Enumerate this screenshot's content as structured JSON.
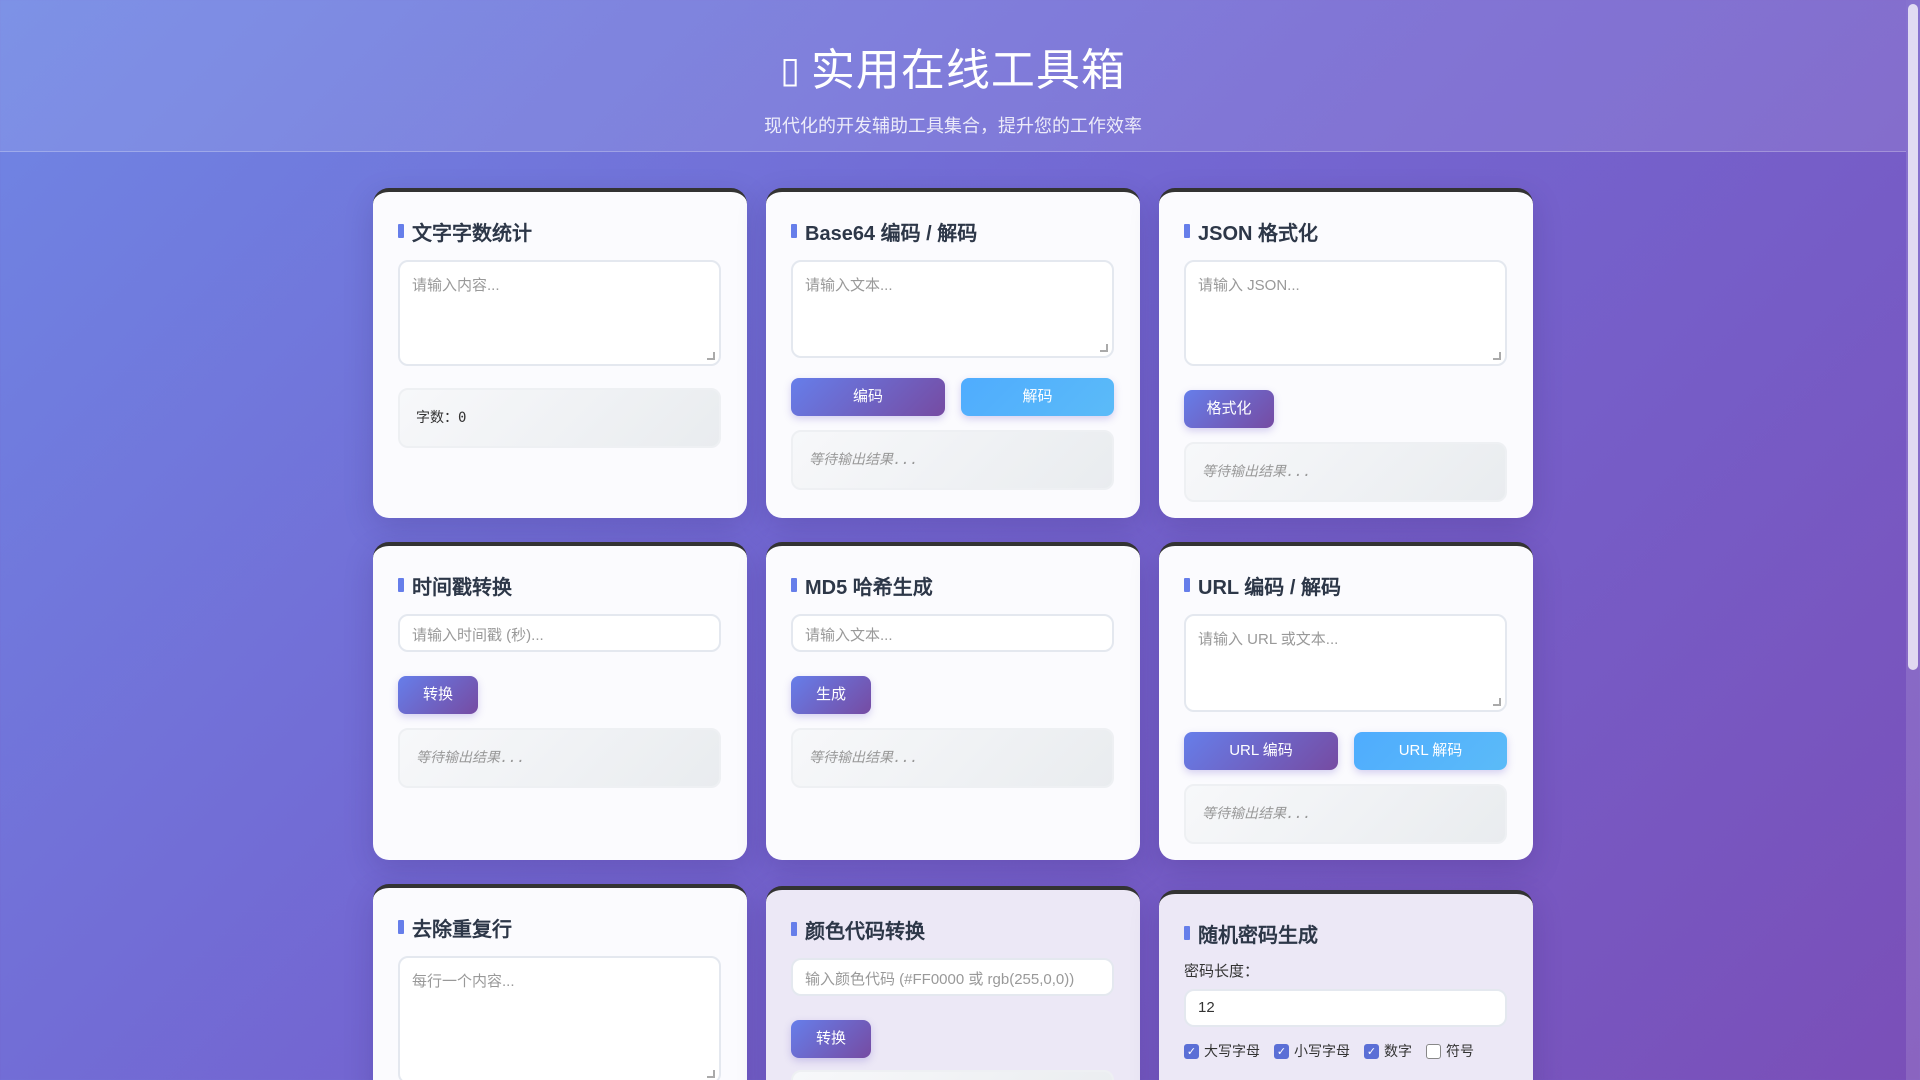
{
  "header": {
    "title": "实用在线工具箱",
    "subtitle": "现代化的开发辅助工具集合，提升您的工作效率",
    "title_icon": "toolbox-icon"
  },
  "cards": {
    "word_count": {
      "title": "文字字数统计",
      "placeholder": "请输入内容...",
      "result": "字数：0"
    },
    "base64": {
      "title": "Base64 编码 / 解码",
      "placeholder": "请输入文本...",
      "encode": "编码",
      "decode": "解码",
      "result": "等待输出结果..."
    },
    "json": {
      "title": "JSON 格式化",
      "placeholder": "请输入 JSON...",
      "format": "格式化",
      "result": "等待输出结果..."
    },
    "timestamp": {
      "title": "时间戳转换",
      "placeholder": "请输入时间戳 (秒)...",
      "convert": "转换",
      "result": "等待输出结果..."
    },
    "md5": {
      "title": "MD5 哈希生成",
      "placeholder": "请输入文本...",
      "generate": "生成",
      "result": "等待输出结果..."
    },
    "url": {
      "title": "URL 编码 / 解码",
      "placeholder": "请输入 URL 或文本...",
      "encode": "URL 编码",
      "decode": "URL 解码",
      "result": "等待输出结果..."
    },
    "dedupe": {
      "title": "去除重复行",
      "placeholder": "每行一个内容..."
    },
    "color": {
      "title": "颜色代码转换",
      "placeholder": "输入颜色代码 (#FF0000 或 rgb(255,0,0))",
      "convert": "转换"
    },
    "password": {
      "title": "随机密码生成",
      "length_label": "密码长度：",
      "length_value": "12",
      "options": [
        {
          "label": "大写字母",
          "checked": true
        },
        {
          "label": "小写字母",
          "checked": true
        },
        {
          "label": "数字",
          "checked": true
        },
        {
          "label": "符号",
          "checked": false
        }
      ]
    }
  }
}
